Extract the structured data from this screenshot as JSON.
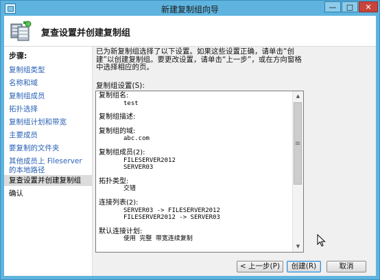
{
  "window": {
    "title": "新建复制组向导",
    "controls": {
      "minimize": "—",
      "maximize": "□",
      "close": "✕"
    }
  },
  "header": {
    "title": "复查设置并创建复制组"
  },
  "steps": {
    "title": "步骤:",
    "items": [
      {
        "label": "复制组类型",
        "state": "done"
      },
      {
        "label": "名称和域",
        "state": "done"
      },
      {
        "label": "复制组成员",
        "state": "done"
      },
      {
        "label": "拓扑选择",
        "state": "done"
      },
      {
        "label": "复制组计划和带宽",
        "state": "done"
      },
      {
        "label": "主要成员",
        "state": "done"
      },
      {
        "label": "要复制的文件夹",
        "state": "done"
      },
      {
        "label": "其他成员上 Fileserver 的本地路径",
        "state": "done"
      },
      {
        "label": "复查设置并创建复制组",
        "state": "current"
      },
      {
        "label": "确认",
        "state": "future"
      }
    ]
  },
  "description": "已为新复制组选择了以下设置。如果这些设置正确，请单击“创建”以创建复制组。要更改设置，请单击“上一步”，或在方向窗格中选择相应的页。",
  "settings": {
    "label": "复制组设置(S):",
    "sections": [
      {
        "title": "复制组名:",
        "values": [
          "test"
        ]
      },
      {
        "title": "复制组描述:",
        "values": []
      },
      {
        "title": "复制组的域:",
        "values": [
          "abc.com"
        ]
      },
      {
        "title": "复制组成员(2):",
        "values": [
          "FILESERVER2012",
          "SERVER03"
        ]
      },
      {
        "title": "拓扑类型:",
        "values": [
          "交错"
        ]
      },
      {
        "title": "连接列表(2):",
        "values": [
          "SERVER03 -> FILESERVER2012",
          "FILESERVER2012 -> SERVER03"
        ]
      },
      {
        "title": "默认连接计划:",
        "values": [
          "使用 完整 带宽连续复制"
        ]
      }
    ]
  },
  "buttons": {
    "back": "< 上一步(P)",
    "create": "创建(R)",
    "cancel": "取消"
  },
  "colors": {
    "title_bar": "#5fb4df",
    "link": "#2a62b6",
    "close_button": "#c7453c"
  }
}
